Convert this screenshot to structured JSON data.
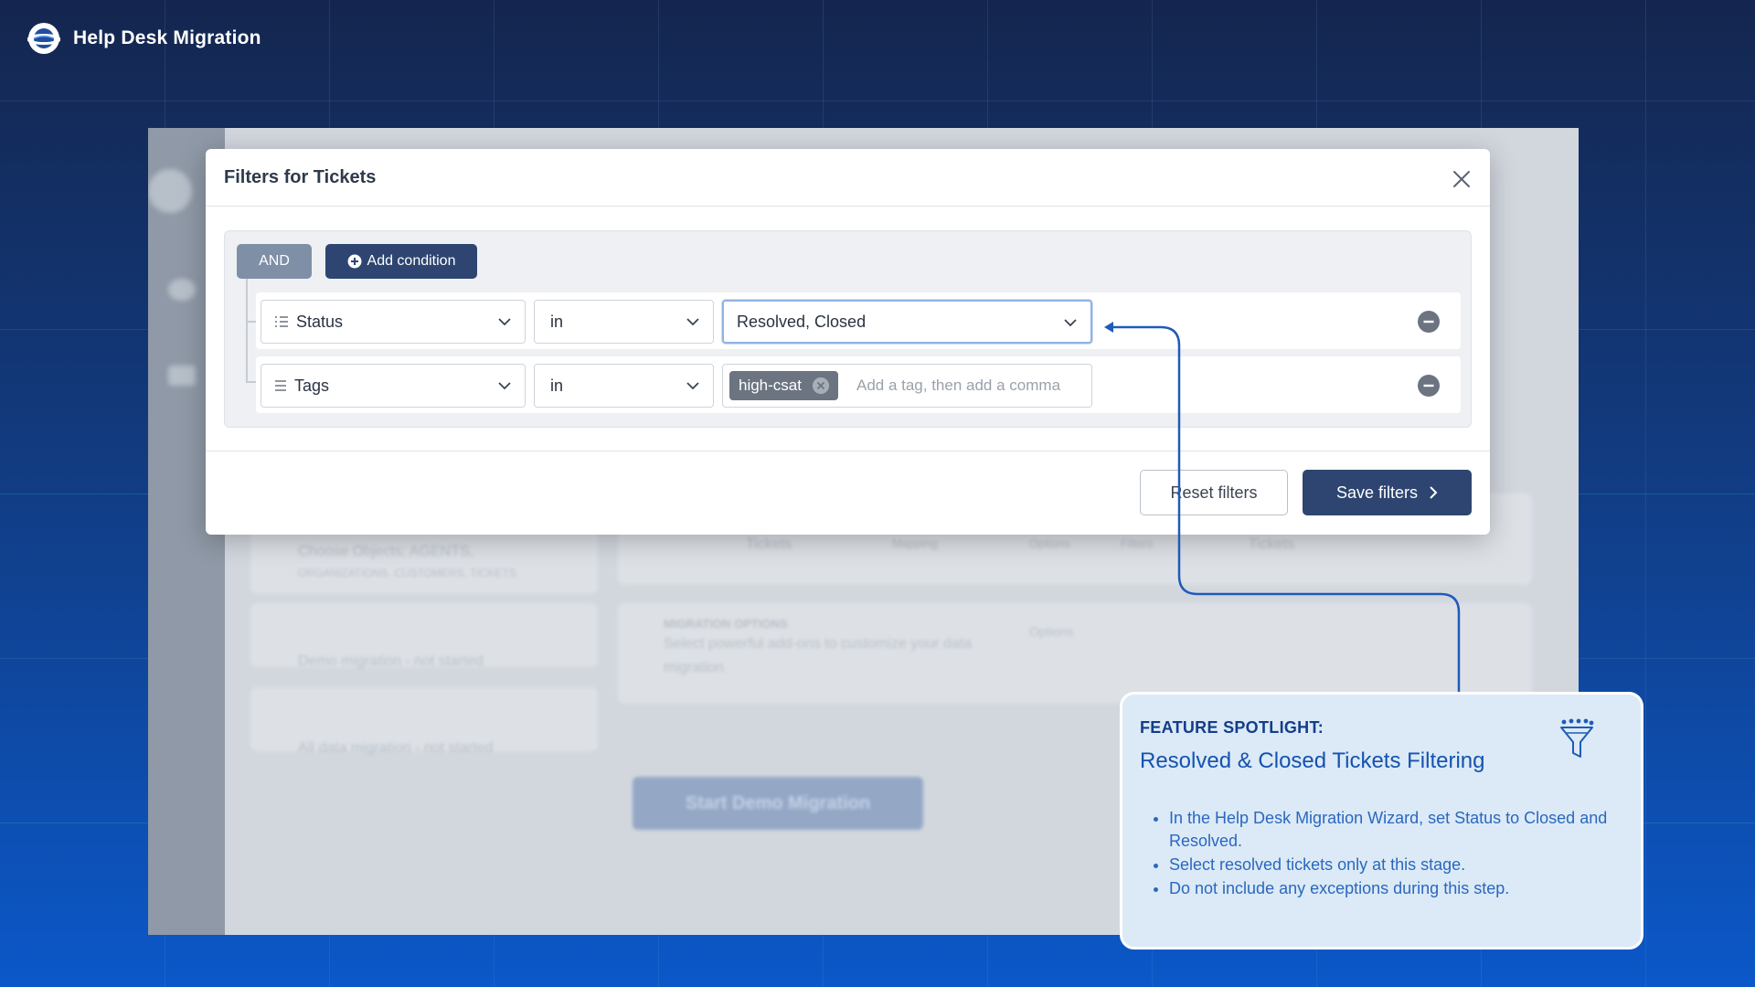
{
  "brand": {
    "name": "Help Desk Migration",
    "logo_icon": "planet-logo-icon"
  },
  "background_app": {
    "blurred_texts": [
      "Choose Objects: AGENTS,",
      "ORGANIZATIONS, CUSTOMERS, TICKETS",
      "Demo migration - not started",
      "All data migration - not started",
      "Tickets",
      "Mapping",
      "Options",
      "Filters",
      "Tickets",
      "MIGRATION OPTIONS",
      "Select powerful add-ons to customize your data",
      "migration",
      "Options"
    ],
    "start_button": "Start Demo Migration"
  },
  "modal": {
    "title": "Filters for Tickets",
    "logic_operator": "AND",
    "add_condition_label": "Add condition",
    "conditions": [
      {
        "field": "Status",
        "field_icon": "status-list-icon",
        "operator": "in",
        "value": "Resolved, Closed"
      },
      {
        "field": "Tags",
        "field_icon": "tags-list-icon",
        "operator": "in",
        "tags": [
          "high-csat"
        ],
        "placeholder": "Add a tag, then add a comma"
      }
    ],
    "reset_label": "Reset filters",
    "save_label": "Save filters"
  },
  "spotlight": {
    "kicker": "FEATURE SPOTLIGHT:",
    "title": "Resolved & Closed Tickets Filtering",
    "icon": "filter-funnel-icon",
    "bullets": [
      "In the Help Desk Migration Wizard, set Status to Closed and Resolved.",
      "Select resolved tickets only at this stage.",
      "Do not include any exceptions during this step."
    ]
  },
  "colors": {
    "primary_button": "#2d4570",
    "and_button": "#7e8fa6",
    "spotlight_bg": "#dbeaf6",
    "connector": "#1f5bb8"
  }
}
